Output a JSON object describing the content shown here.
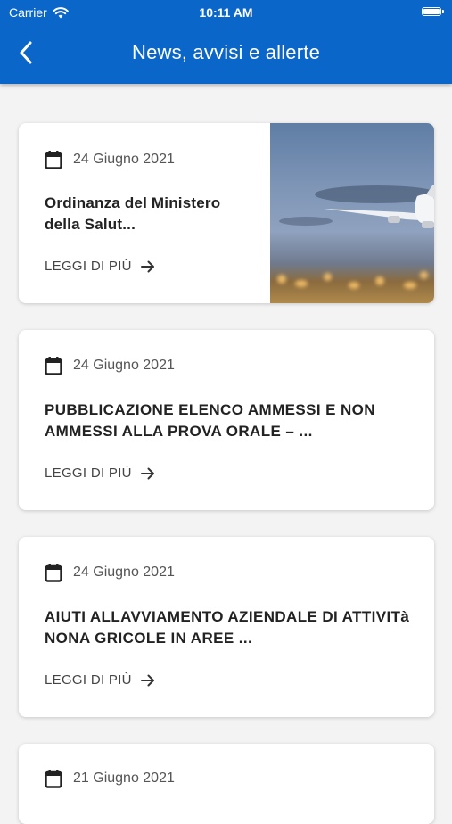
{
  "status_bar": {
    "carrier": "Carrier",
    "time": "10:11 AM"
  },
  "header": {
    "title": "News, avvisi e allerte",
    "back_icon": "chevron-left-icon"
  },
  "colors": {
    "header_bg": "#0a66c8",
    "page_bg": "#f3f3f3",
    "card_bg": "#ffffff"
  },
  "news": [
    {
      "date": "24 Giugno 2021",
      "title": "Ordinanza del Ministero della Salut...",
      "read_more": "LEGGI DI PIÙ",
      "image": "airplane-photo"
    },
    {
      "date": "24 Giugno 2021",
      "title": "PUBBLICAZIONE ELENCO AMMESSI E NON AMMESSI ALLA PROVA ORALE – ...",
      "read_more": "LEGGI DI PIÙ"
    },
    {
      "date": "24 Giugno 2021",
      "title": "AIUTI ALLAVVIAMENTO AZIENDALE DI ATTIVITà NONA GRICOLE IN AREE ...",
      "read_more": "LEGGI DI PIÙ"
    },
    {
      "date": "21 Giugno 2021"
    }
  ]
}
